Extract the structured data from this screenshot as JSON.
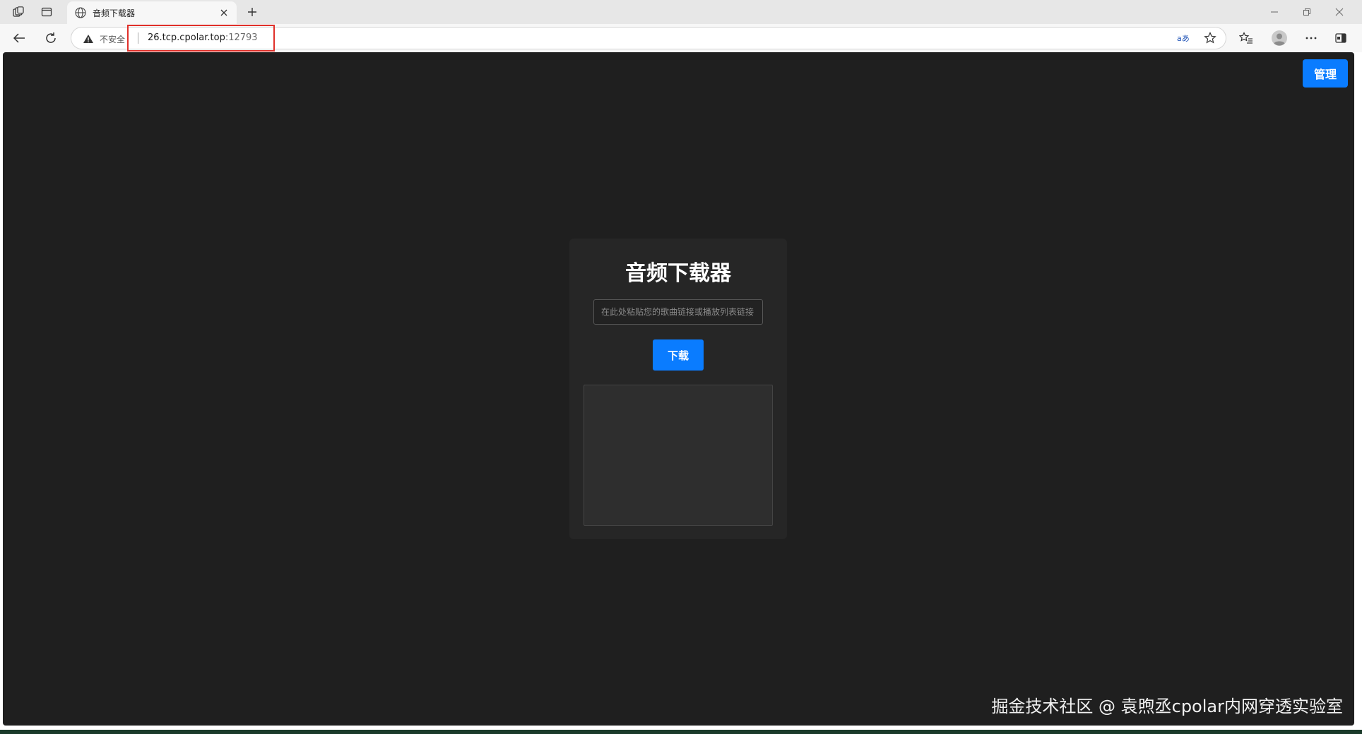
{
  "browser": {
    "tab_title": "音频下载器",
    "address_insecure_label": "不安全",
    "address_url_host": "26.tcp.cpolar.top",
    "address_url_port": ":12793"
  },
  "page": {
    "admin_button": "管理",
    "app_title": "音频下载器",
    "input_placeholder": "在此处粘贴您的歌曲链接或播放列表链接",
    "download_button": "下载"
  },
  "watermark": "掘金技术社区 @ 袁煦丞cpolar内网穿透实验室",
  "colors": {
    "accent": "#0a7cff",
    "page_bg": "#1f1f1f",
    "card_bg": "#262626",
    "highlight_border": "#e0302a"
  }
}
